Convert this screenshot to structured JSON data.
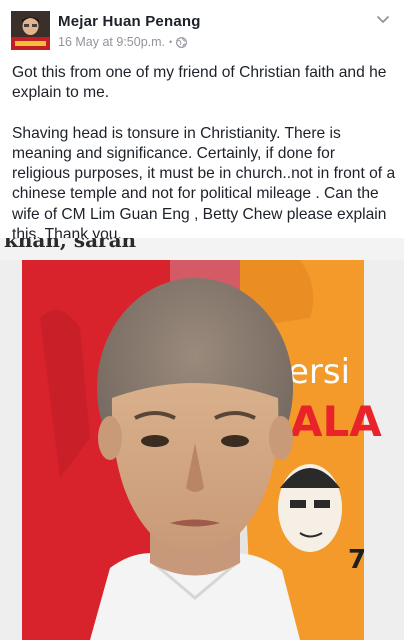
{
  "post": {
    "author_name": "Mejar Huan Penang",
    "timestamp": "16 May at 9:50p.m.",
    "separator": "•",
    "audience_icon": "globe-icon",
    "menu_icon": "chevron-down-icon",
    "paragraphs": [
      "Got this from one of my friend of Christian faith and he explain to me.",
      "Shaving head is tonsure in Christianity. There is meaning and significance. Certainly, if done for religious purposes, it must be in church..not in front of a chinese temple and not for political mileage . Can the wife of CM Lim Guan Eng , Betty Chew please explain this. Thank you."
    ]
  },
  "image": {
    "description_icon": "shaved-head-woman-photo",
    "banner_text": "ersi",
    "banner_text_2": "ALA",
    "banner_number": "7",
    "clipped_caption": "khan, saran"
  },
  "colors": {
    "text": "#1d2129",
    "meta": "#90949c",
    "shirt_red": "#d8232c",
    "shirt_orange": "#f39a2a"
  }
}
